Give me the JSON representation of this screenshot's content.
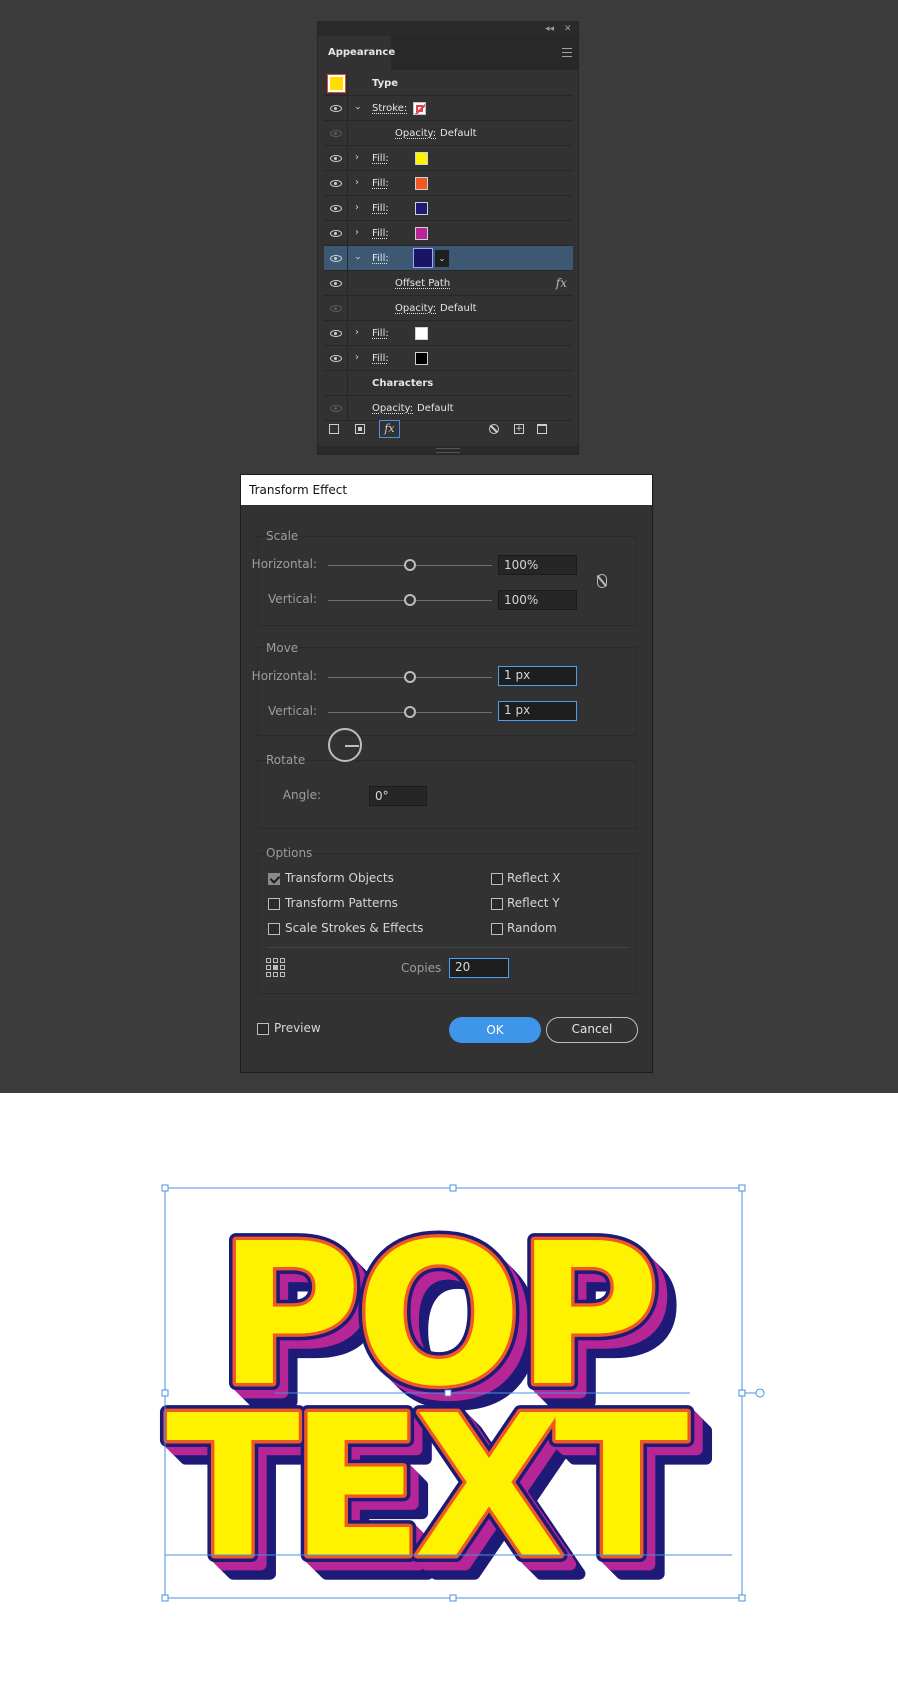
{
  "appearance": {
    "tab": "Appearance",
    "collapse_glyph": "◂◂",
    "close_glyph": "✕",
    "type_label": "Type",
    "stroke_label": "Stroke:",
    "opacity_label": "Opacity:",
    "opacity_value": "Default",
    "fill_label": "Fill:",
    "offset_path_label": "Offset Path",
    "fx_glyph": "fx",
    "characters_label": "Characters",
    "dropdown_glyph": "⌄",
    "fill_colors": [
      "#fff200",
      "#f05a22",
      "#1e1a78",
      "#b62696",
      "#1a1465",
      "#ffffff",
      "#000000"
    ],
    "type_swatch_color": "#ffdd00"
  },
  "dialog": {
    "title": "Transform Effect",
    "scale": {
      "title": "Scale",
      "horizontal_label": "Horizontal:",
      "horizontal_value": "100%",
      "vertical_label": "Vertical:",
      "vertical_value": "100%"
    },
    "move": {
      "title": "Move",
      "horizontal_label": "Horizontal:",
      "horizontal_value": "1 px",
      "vertical_label": "Vertical:",
      "vertical_value": "1 px"
    },
    "rotate": {
      "title": "Rotate",
      "angle_label": "Angle:",
      "angle_value": "0°"
    },
    "options": {
      "title": "Options",
      "transform_objects": "Transform Objects",
      "transform_objects_checked": true,
      "transform_patterns": "Transform Patterns",
      "scale_strokes": "Scale Strokes & Effects",
      "reflect_x": "Reflect X",
      "reflect_y": "Reflect Y",
      "random": "Random",
      "copies_label": "Copies",
      "copies_value": "20"
    },
    "preview_label": "Preview",
    "ok_label": "OK",
    "cancel_label": "Cancel"
  },
  "artwork": {
    "line1": "POP",
    "line2": "TEXT",
    "colors": {
      "face": "#fff200",
      "outline": "#f05a22",
      "shadow_purple": "#b62696",
      "shadow_navy": "#1e1a78",
      "selection": "#4a90e2"
    }
  }
}
